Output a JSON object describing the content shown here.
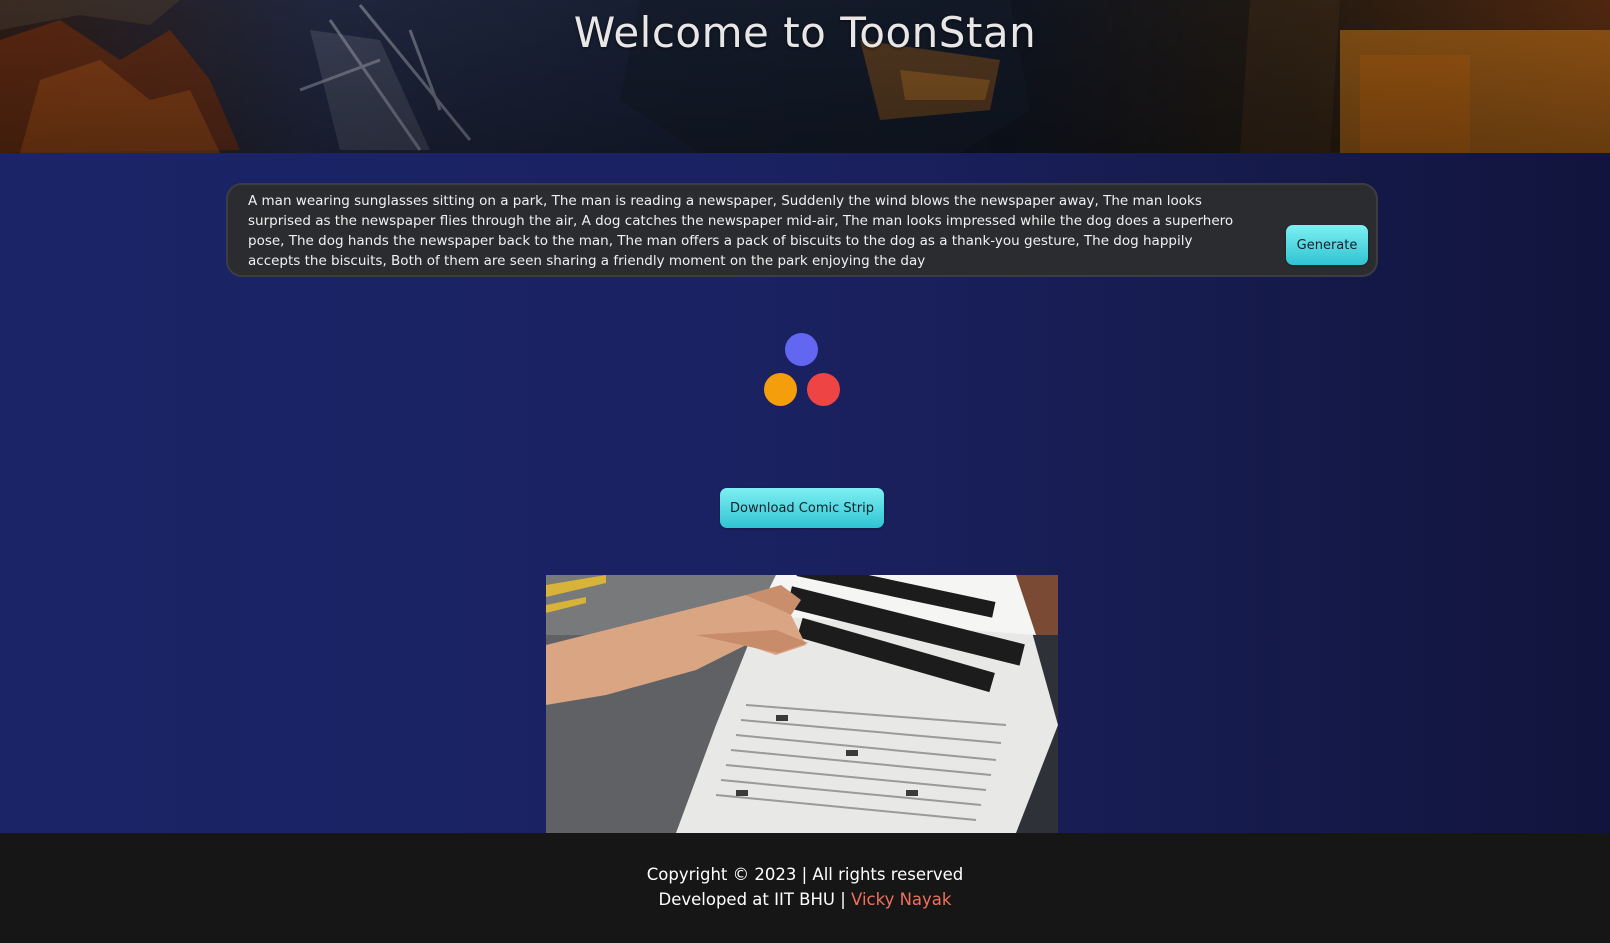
{
  "header": {
    "title": "Welcome to ToonStan"
  },
  "prompt": {
    "value": "A man wearing sunglasses sitting on a park, The man is reading a newspaper, Suddenly the wind blows the newspaper away, The man looks surprised as the newspaper flies through the air, A dog catches the newspaper mid-air, The man looks impressed while the dog does a superhero pose, The dog hands the newspaper back to the man, The man offers a pack of biscuits to the dog as a thank-you gesture, The dog happily accepts the biscuits, Both of them are seen sharing a friendly moment on the park enjoying the day",
    "generate_label": "Generate"
  },
  "loader": {
    "colors": [
      "#6366f1",
      "#f59e0b",
      "#ef4444"
    ]
  },
  "download": {
    "label": "Download Comic Strip"
  },
  "colors": {
    "accent_cyan": "#2fc3d3",
    "main_bg": "#1a2466",
    "footer_bg": "#161616",
    "author_link": "#f0705a"
  },
  "footer": {
    "copyright": "Copyright © 2023 | All rights reserved",
    "developed_prefix": "Developed at IIT BHU | ",
    "author": "Vicky Nayak"
  }
}
